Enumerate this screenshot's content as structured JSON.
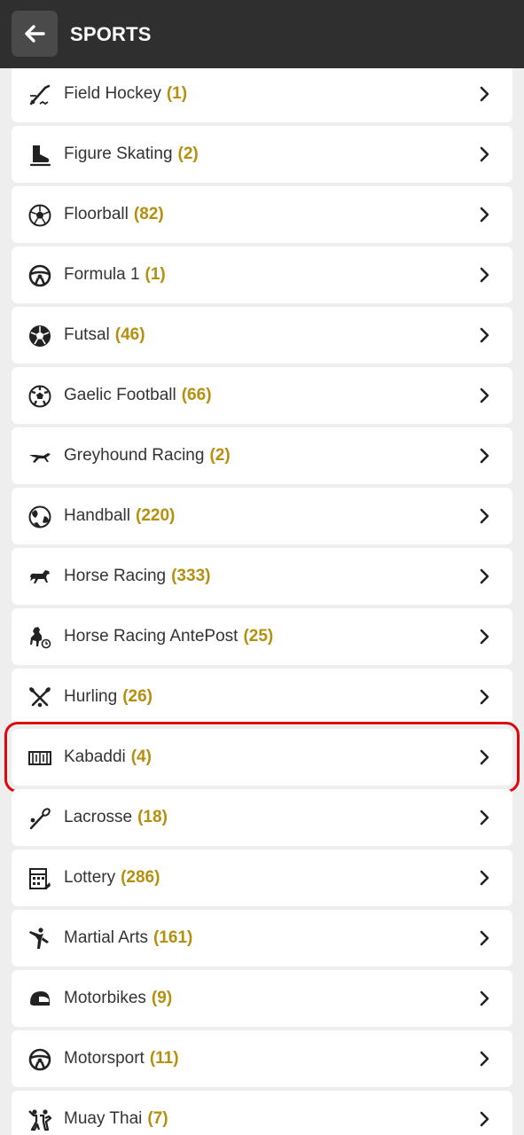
{
  "header": {
    "title": "SPORTS",
    "back_icon": "arrow-left-icon"
  },
  "sports": [
    {
      "label": "Field Hockey",
      "count": "(1)",
      "icon": "field-hockey-icon"
    },
    {
      "label": "Figure Skating",
      "count": "(2)",
      "icon": "skate-icon"
    },
    {
      "label": "Floorball",
      "count": "(82)",
      "icon": "ball-icon"
    },
    {
      "label": "Formula 1",
      "count": "(1)",
      "icon": "steering-wheel-icon"
    },
    {
      "label": "Futsal",
      "count": "(46)",
      "icon": "futsal-ball-icon"
    },
    {
      "label": "Gaelic Football",
      "count": "(66)",
      "icon": "soccer-ball-icon"
    },
    {
      "label": "Greyhound Racing",
      "count": "(2)",
      "icon": "greyhound-icon"
    },
    {
      "label": "Handball",
      "count": "(220)",
      "icon": "handball-icon"
    },
    {
      "label": "Horse Racing",
      "count": "(333)",
      "icon": "horse-icon"
    },
    {
      "label": "Horse Racing AntePost",
      "count": "(25)",
      "icon": "horse-clock-icon"
    },
    {
      "label": "Hurling",
      "count": "(26)",
      "icon": "hurling-sticks-icon"
    },
    {
      "label": "Kabaddi",
      "count": "(4)",
      "icon": "kabaddi-court-icon"
    },
    {
      "label": "Lacrosse",
      "count": "(18)",
      "icon": "lacrosse-icon"
    },
    {
      "label": "Lottery",
      "count": "(286)",
      "icon": "lottery-ticket-icon"
    },
    {
      "label": "Martial Arts",
      "count": "(161)",
      "icon": "martial-arts-icon"
    },
    {
      "label": "Motorbikes",
      "count": "(9)",
      "icon": "helmet-icon"
    },
    {
      "label": "Motorsport",
      "count": "(11)",
      "icon": "steering-wheel-icon"
    },
    {
      "label": "Muay Thai",
      "count": "(7)",
      "icon": "muay-thai-icon"
    }
  ],
  "highlighted_label": "Kabaddi",
  "colors": {
    "header_bg": "#2f2f2f",
    "count": "#b58f0e",
    "highlight": "#e0060f",
    "page_bg": "#eeeeee"
  }
}
